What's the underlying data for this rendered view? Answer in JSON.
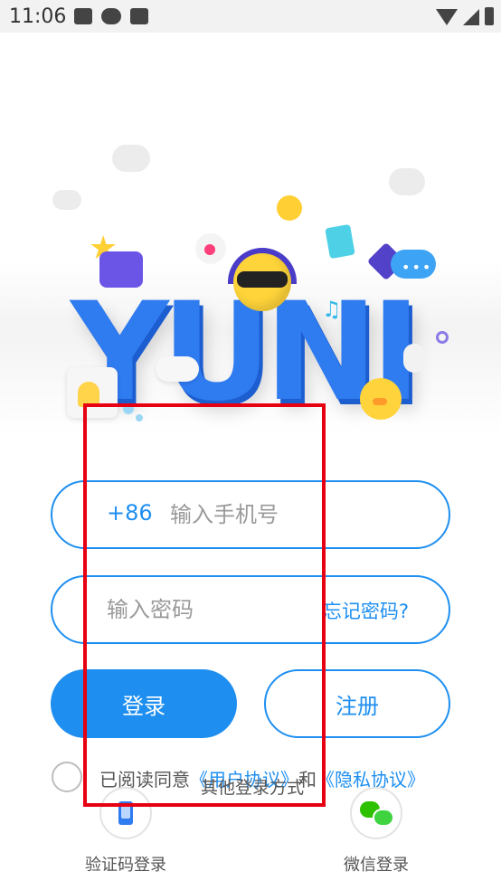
{
  "status_bar": {
    "time": "11:06"
  },
  "hero": {
    "logo_text": "YUNI",
    "chat_dots": "•••"
  },
  "login_form": {
    "country_code": "+86",
    "phone_placeholder": "输入手机号",
    "password_placeholder": "输入密码",
    "forgot_password": "忘记密码?",
    "login_button": "登录",
    "register_button": "注册"
  },
  "agreement": {
    "prefix": "已阅读同意",
    "user_agreement": "《用户协议》",
    "conjunction": "和",
    "privacy_agreement": "《隐私协议》"
  },
  "other_login": {
    "title": "其他登录方式",
    "sms_login": "验证码登录",
    "wechat_login": "微信登录"
  },
  "colors": {
    "accent": "#1e8ff0",
    "highlight": "#e60012"
  }
}
